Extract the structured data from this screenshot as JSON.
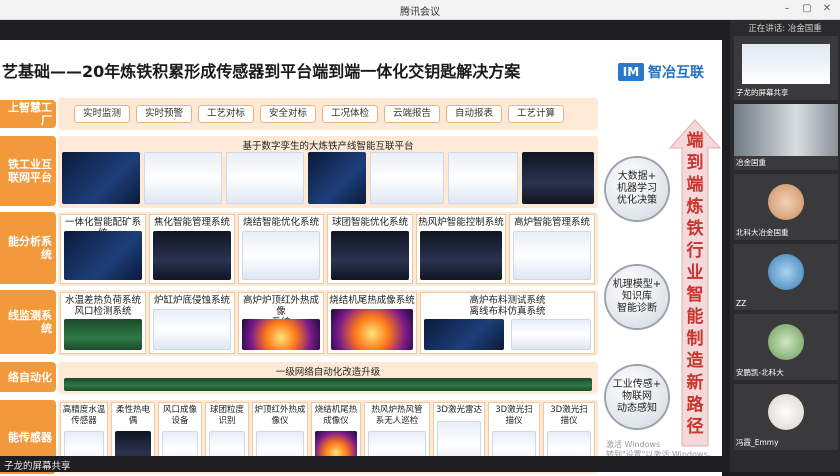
{
  "window": {
    "title": "腾讯会议"
  },
  "slide": {
    "title": "艺基础——20年炼铁积累形成传感器到平台端到端一体化交钥匙解决方案",
    "logo_mark": "IM",
    "logo_text": "智冶互联",
    "bands": [
      "上智慧工厂",
      "铁工业互联网平台",
      "能分析系统",
      "线监测系统",
      "络自动化",
      "能传感器"
    ],
    "top_pills": [
      "实时监测",
      "实时预警",
      "工艺对标",
      "安全对标",
      "工况体检",
      "云端报告",
      "自动报表",
      "工艺计算"
    ],
    "platform_label": "基于数字孪生的大炼铁产线智能互联平台",
    "analysis_tiles": [
      "一体化智能配矿系统",
      "焦化智能管理系统",
      "烧结智能优化系统",
      "球团智能优化系统",
      "热风炉智能控制系统",
      "高炉智能管理系统"
    ],
    "monitor_tiles": [
      "水温差热负荷系统\n风口检测系统",
      "炉缸炉底侵蚀系统",
      "高炉炉顶红外热成像\n系统",
      "烧结机尾热成像系统",
      "高炉布料测试系统\n离线布料仿真系统"
    ],
    "network_label": "一级网络自动化改造升级",
    "sensor_tiles": [
      "高精度水温\n传感器",
      "柔性热电\n偶",
      "风口成像\n设备",
      "球团粒度\n识别",
      "炉顶红外热成\n像仪",
      "烧结机尾热\n成像仪",
      "热风炉热风管\n系无人巡检",
      "3D激光雷达",
      "3D激光扫\n描仪",
      "3D激光扫\n描仪"
    ],
    "side_circles": [
      "大数据+\n机器学习\n优化决策",
      "机理模型+\n知识库\n智能诊断",
      "工业传感+\n物联网\n动态感知"
    ],
    "arrow_text": "端到端炼铁行业智能制造新路径",
    "watermark": "激活 Windows\n转到\"设置\"以激活 Windows。"
  },
  "share_tag": "子龙的屏幕共享",
  "participants": {
    "speaking_label": "正在讲话: 冶金国重",
    "list": [
      {
        "name": "子龙的屏幕共享"
      },
      {
        "name": "冶金国重"
      },
      {
        "name": "北科大冶金国重"
      },
      {
        "name": "ZZ"
      },
      {
        "name": "安鹏凯-北科大"
      },
      {
        "name": "冯霞_Emmy"
      }
    ]
  }
}
